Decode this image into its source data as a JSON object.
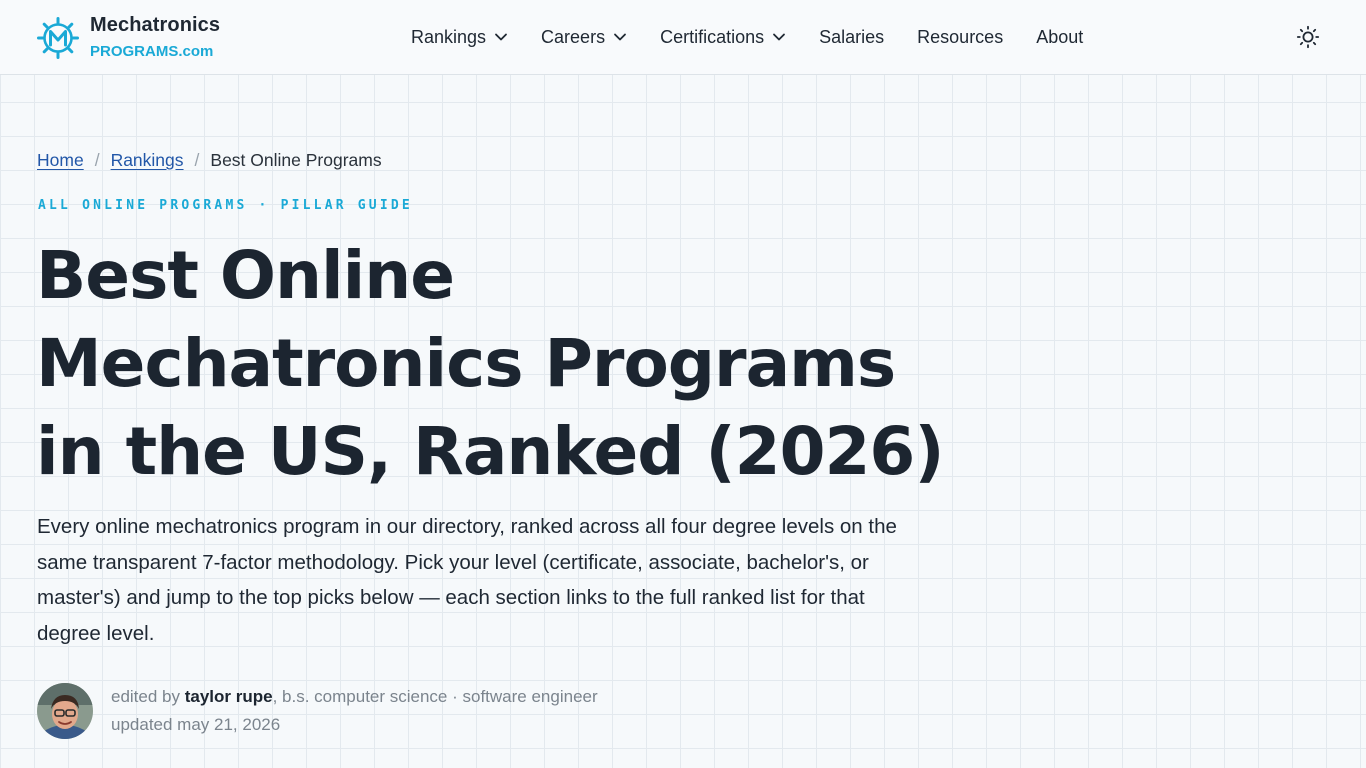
{
  "header": {
    "logo": {
      "name": "Mechatronics",
      "sub": "PROGRAMS.com",
      "icon": "m-gear-logo"
    },
    "nav": [
      {
        "label": "Rankings",
        "has_dropdown": true
      },
      {
        "label": "Careers",
        "has_dropdown": true
      },
      {
        "label": "Certifications",
        "has_dropdown": true
      },
      {
        "label": "Salaries",
        "has_dropdown": false
      },
      {
        "label": "Resources",
        "has_dropdown": false
      },
      {
        "label": "About",
        "has_dropdown": false
      }
    ],
    "theme_toggle_icon": "sun-icon"
  },
  "breadcrumb": {
    "items": [
      {
        "label": "Home"
      },
      {
        "label": "Rankings"
      }
    ],
    "separator": "/",
    "current": "Best Online Programs"
  },
  "eyebrow": "ALL ONLINE PROGRAMS · PILLAR GUIDE",
  "title": "Best Online Mechatronics Programs in the US, Ranked (2026)",
  "lede": "Every online mechatronics program in our directory, ranked across all four degree levels on the same transparent 7-factor methodology. Pick your level (certificate, associate, bachelor's, or master's) and jump to the top picks below — each section links to the full ranked list for that degree level.",
  "byline": {
    "prefix": "edited by",
    "author": "taylor rupe",
    "credentials": ", b.s. computer science · software engineer",
    "updated": "updated may 21, 2026"
  },
  "colors": {
    "accent": "#1aa9d6",
    "link": "#2257a8",
    "text": "#1c2530",
    "muted": "#7b848d",
    "background": "#f6f9fb"
  }
}
